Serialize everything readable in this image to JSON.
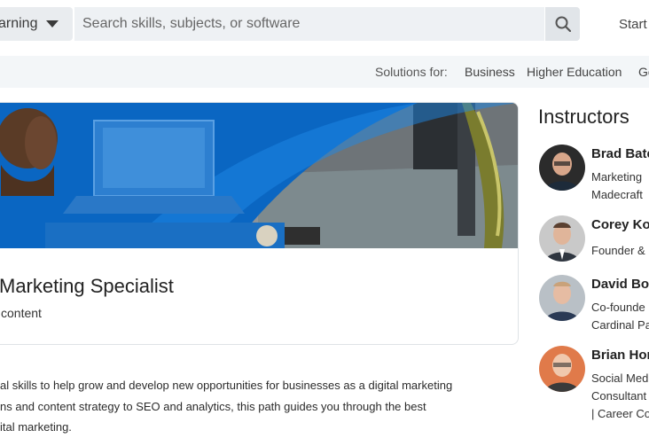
{
  "header": {
    "learning_label": "arning",
    "search_placeholder": "Search skills, subjects, or software",
    "start_label": "Start"
  },
  "solutions": {
    "label": "Solutions for:",
    "items": [
      "Business",
      "Higher Education",
      "Go"
    ]
  },
  "course": {
    "title": "Marketing Specialist",
    "meta": "content",
    "description_lines": [
      "al skills to help grow and develop new opportunities for businesses as a digital marketing",
      "ns and content strategy to SEO and analytics, this path guides you through the best",
      "ital marketing."
    ]
  },
  "instructors": {
    "heading": "Instructors",
    "items": [
      {
        "name": "Brad Bate",
        "role_lines": [
          "Marketing",
          "Madecraft"
        ]
      },
      {
        "name": "Corey Ko",
        "role_lines": [
          "Founder &"
        ]
      },
      {
        "name": "David Bo",
        "role_lines": [
          "Co-founde",
          "Cardinal Pa"
        ]
      },
      {
        "name": "Brian Hor",
        "role_lines": [
          "Social Med",
          "Consultant",
          "| Career Co"
        ]
      }
    ]
  },
  "colors": {
    "accent_blue": "#0a66c2",
    "surface_gray": "#e9ecef",
    "solutions_bg": "#f3f6f8"
  },
  "icons": {
    "search": "search-icon",
    "dropdown": "caret-down-icon"
  }
}
